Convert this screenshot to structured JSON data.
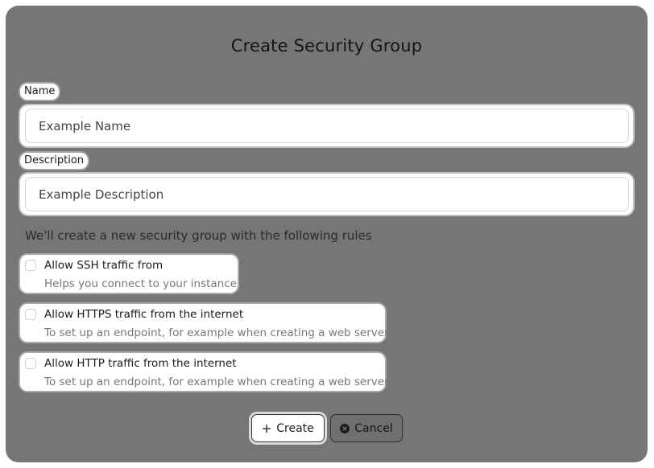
{
  "dialog": {
    "title": "Create Security Group"
  },
  "name_field": {
    "label": "Name",
    "placeholder": "Example Name",
    "value": ""
  },
  "description_field": {
    "label": "Description",
    "placeholder": "Example Description",
    "value": ""
  },
  "note": "We'll create a new security group with the following rules",
  "rules": [
    {
      "title": "Allow SSH traffic from",
      "description": "Helps you connect to your instance",
      "checked": false
    },
    {
      "title": "Allow HTTPS traffic from the internet",
      "description": "To set up an endpoint, for example when creating a web server",
      "checked": false
    },
    {
      "title": "Allow HTTP traffic from the internet",
      "description": "To set up an endpoint, for example when creating a web server",
      "checked": false
    }
  ],
  "buttons": {
    "create_label": "Create",
    "create_icon": "plus-icon",
    "cancel_label": "Cancel",
    "cancel_icon": "x-circle-icon"
  },
  "colors": {
    "dialog_bg": "#767676",
    "field_bg": "#ffffff"
  }
}
